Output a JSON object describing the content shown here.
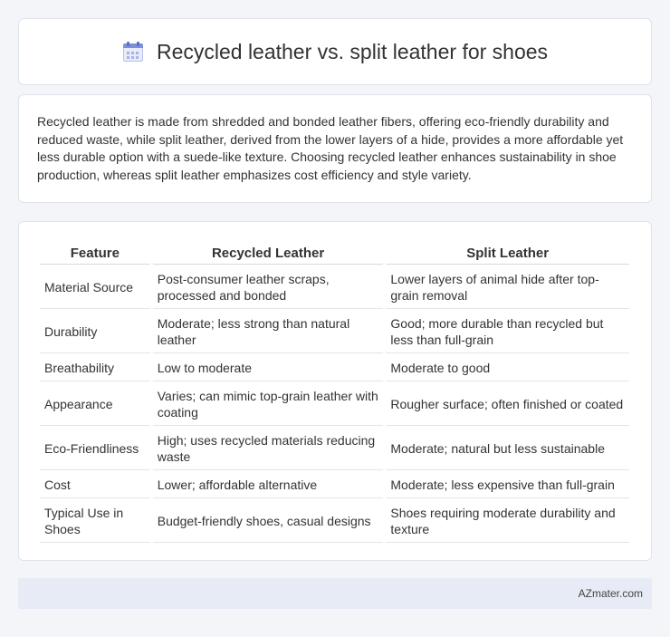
{
  "header": {
    "title": "Recycled leather vs. split leather for shoes",
    "icon": "calendar-icon"
  },
  "intro": {
    "text": "Recycled leather is made from shredded and bonded leather fibers, offering eco-friendly durability and reduced waste, while split leather, derived from the lower layers of a hide, provides a more affordable yet less durable option with a suede-like texture. Choosing recycled leather enhances sustainability in shoe production, whereas split leather emphasizes cost efficiency and style variety."
  },
  "table": {
    "headers": [
      "Feature",
      "Recycled Leather",
      "Split Leather"
    ],
    "rows": [
      [
        "Material Source",
        "Post-consumer leather scraps, processed and bonded",
        "Lower layers of animal hide after top-grain removal"
      ],
      [
        "Durability",
        "Moderate; less strong than natural leather",
        "Good; more durable than recycled but less than full-grain"
      ],
      [
        "Breathability",
        "Low to moderate",
        "Moderate to good"
      ],
      [
        "Appearance",
        "Varies; can mimic top-grain leather with coating",
        "Rougher surface; often finished or coated"
      ],
      [
        "Eco-Friendliness",
        "High; uses recycled materials reducing waste",
        "Moderate; natural but less sustainable"
      ],
      [
        "Cost",
        "Lower; affordable alternative",
        "Moderate; less expensive than full-grain"
      ],
      [
        "Typical Use in Shoes",
        "Budget-friendly shoes, casual designs",
        "Shoes requiring moderate durability and texture"
      ]
    ]
  },
  "footer": {
    "brand": "AZmater.com"
  }
}
